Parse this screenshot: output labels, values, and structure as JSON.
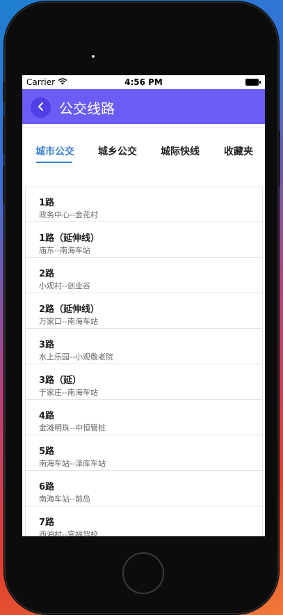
{
  "status_bar": {
    "carrier": "Carrier",
    "time": "4:56 PM"
  },
  "nav": {
    "title": "公交线路",
    "back_icon": "chevron-left-icon",
    "color": "#6b5cf6"
  },
  "tabs": [
    {
      "label": "城市公交",
      "active": true
    },
    {
      "label": "城乡公交",
      "active": false
    },
    {
      "label": "城际快线",
      "active": false
    },
    {
      "label": "收藏夹",
      "active": false
    }
  ],
  "accent_color": "#3b82d6",
  "routes": [
    {
      "name": "1路",
      "stops": "政务中心--金花村"
    },
    {
      "name": "1路（延伸线）",
      "stops": "庙东--南海车站"
    },
    {
      "name": "2路",
      "stops": "小观村--创业谷"
    },
    {
      "name": "2路（延伸线）",
      "stops": "万家口--南海车站"
    },
    {
      "name": "3路",
      "stops": "水上乐园--小观敬老院"
    },
    {
      "name": "3路（延）",
      "stops": "于家庄--南海车站"
    },
    {
      "name": "4路",
      "stops": "金滩明珠--中恒管桩"
    },
    {
      "name": "5路",
      "stops": "南海车站--泽库车站"
    },
    {
      "name": "6路",
      "stops": "南海车站--前岛"
    },
    {
      "name": "7路",
      "stops": "西泊村--宫福驾校"
    }
  ]
}
